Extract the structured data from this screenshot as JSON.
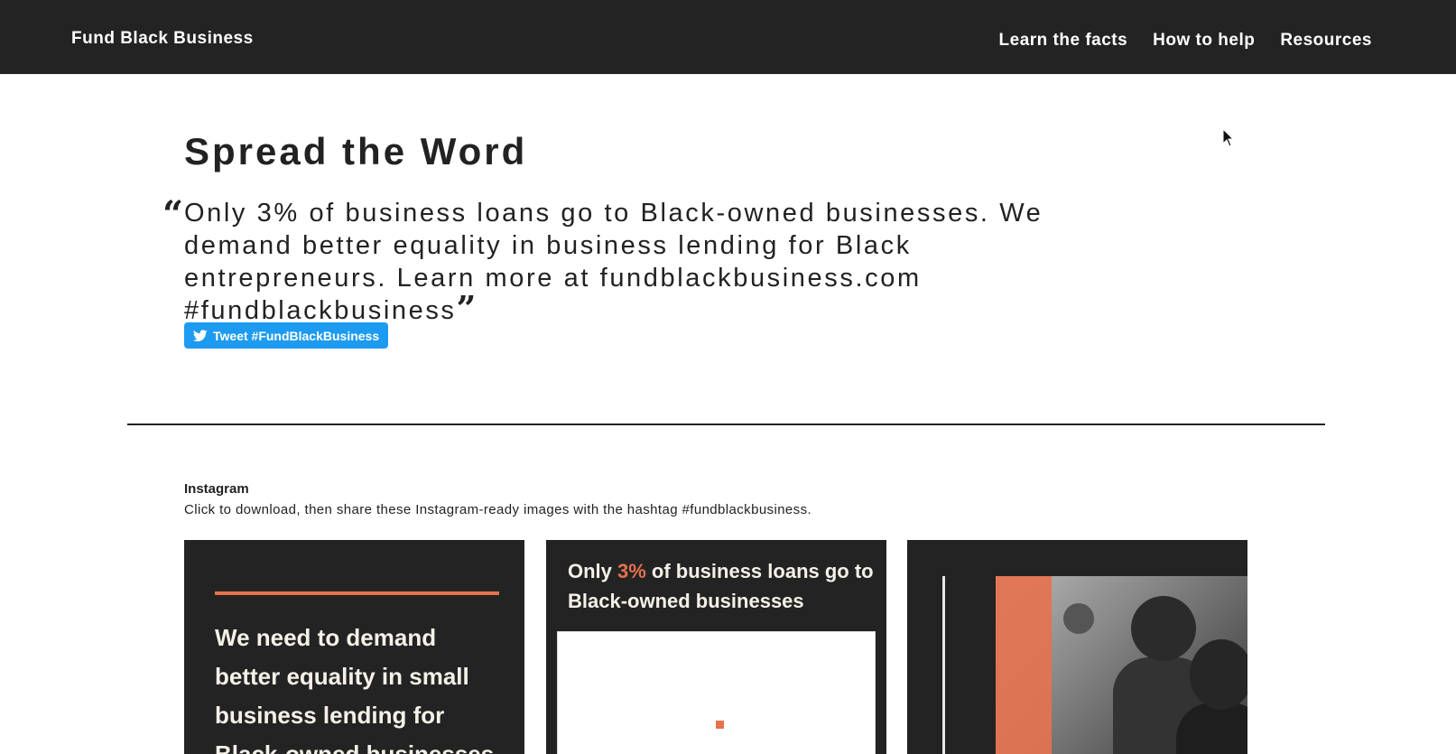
{
  "nav": {
    "brand": "Fund Black Business",
    "links": [
      "Learn the facts",
      "How to help",
      "Resources"
    ]
  },
  "main": {
    "title": "Spread the Word",
    "quote_open": "“",
    "quote": "Only 3% of business loans go to Black-owned businesses. We demand better equality in business lending for Black entrepreneurs. Learn more at fundblackbusiness.com #fundblackbusiness",
    "quote_close": "”",
    "tweet_button": "Tweet #FundBlackBusiness"
  },
  "instagram": {
    "heading": "Instagram",
    "description": "Click to download, then share these Instagram-ready images with the hashtag #fundblackbusiness.",
    "card1_text": "We need to demand better equality in small business lending for Black-owned businesses",
    "card2_prefix": "Only ",
    "card2_accent": "3%",
    "card2_suffix": " of business loans go to Black-owned businesses"
  },
  "icons": {
    "tweet": "twitter-bird-icon",
    "cursor": "mouse-cursor-icon"
  },
  "colors": {
    "nav_bg": "#232323",
    "accent": "#e4724f",
    "twitter": "#1d9bf0",
    "text": "#222222"
  }
}
